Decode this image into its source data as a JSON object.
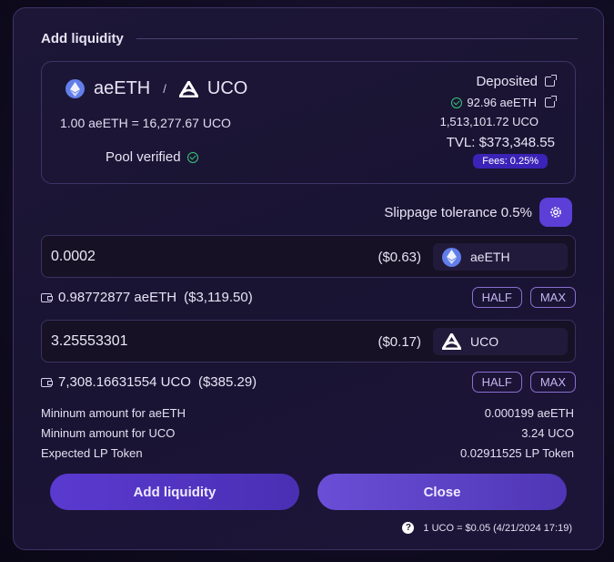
{
  "title": "Add liquidity",
  "pool": {
    "token1": "aeETH",
    "separator": "/",
    "token2": "UCO",
    "rate": "1.00 aeETH = 16,277.67 UCO",
    "verified_label": "Pool verified",
    "deposited_label": "Deposited",
    "deposited_token1": "92.96 aeETH",
    "deposited_token2": "1,513,101.72 UCO",
    "tvl": "TVL: $373,348.55",
    "fees": "Fees: 0.25%"
  },
  "slippage": "Slippage tolerance 0.5%",
  "input1": {
    "value": "0.0002",
    "usd": "($0.63)",
    "token": "aeETH",
    "balance": "0.98772877 aeETH",
    "balance_usd": "($3,119.50)",
    "half": "HALF",
    "max": "MAX"
  },
  "input2": {
    "value": "3.25553301",
    "usd": "($0.17)",
    "token": "UCO",
    "balance": "7,308.16631554 UCO",
    "balance_usd": "($385.29)",
    "half": "HALF",
    "max": "MAX"
  },
  "details": [
    {
      "label": "Mininum amount for aeETH",
      "value": "0.000199 aeETH"
    },
    {
      "label": "Mininum amount for UCO",
      "value": "3.24 UCO"
    },
    {
      "label": "Expected LP Token",
      "value": "0.02911525 LP Token"
    }
  ],
  "buttons": {
    "add": "Add liquidity",
    "close": "Close"
  },
  "footer": {
    "help": "?",
    "price": "1 UCO = $0.05 (4/21/2024 17:19)"
  },
  "colors": {
    "accent": "#5b3fd6",
    "verified": "#36c97a",
    "fees_bg": "#3b23b8"
  },
  "icons": [
    "ethereum-icon",
    "uco-icon",
    "check-circle-icon",
    "external-link-icon",
    "gear-icon",
    "wallet-icon",
    "help-icon"
  ]
}
